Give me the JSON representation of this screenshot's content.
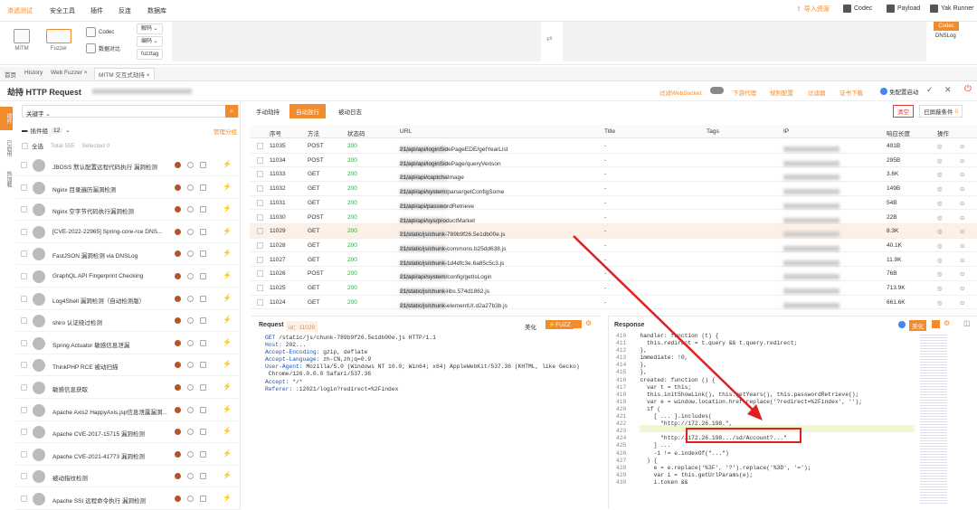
{
  "menubar": {
    "items": [
      "渗透测试",
      "安全工具",
      "插件",
      "反连",
      "数据库"
    ],
    "right": [
      "导入资源",
      "Codec",
      "Payload",
      "Yak Runner"
    ]
  },
  "toolbar": {
    "mitm": "MITM",
    "fuzzer": "Fuzzer",
    "codec": "Codec",
    "compare": "数据对比",
    "decode": "解码",
    "encode": "编码",
    "fuzztag": "fuzztag",
    "codec_tag": "Codec",
    "dnslog": "DNSLog"
  },
  "tabs": [
    "首页",
    "History",
    "Web Fuzzer",
    "MITM 交互式劫持"
  ],
  "header": {
    "title": "劫持 HTTP Request",
    "filter_ws": "过滤WebSocket:",
    "dl_proxy": "下游代理",
    "rule_config": "规则配置",
    "filter": "过滤器",
    "cert": "证书下载",
    "fav_launch": "免配置启动"
  },
  "side_tabs": [
    "插件",
    "已启用",
    "热加载"
  ],
  "left": {
    "keyword": "关键字",
    "plugin_group": "插件组",
    "group_count": "12",
    "manage_group": "管理分组",
    "select_all": "全选",
    "total": "Total 555",
    "selected": "Selected 0",
    "plugins": [
      "JBOSS 默认配置远程代码执行 漏洞检测",
      "Nginx 目录遍历漏洞检测",
      "Nginx 空字节代码执行漏洞检测",
      "[CVE-2022-22965] Spring-core-rce DNS...",
      "FastJSON 漏洞检测 via DNSLog",
      "GraphQL API Fingerprint Checking",
      "Log4Shell 漏洞检测（自动检测版）",
      "shiro 认证绕过检测",
      "Spring Actuator 敏感信息泄漏",
      "ThinkPHP RCE 被动扫描",
      "敏感信息获取",
      "Apache Axis2 HappyAxis.jsp信息泄露漏洞...",
      "Apache CVE-2017-15715 漏洞检测",
      "Apache CVE-2021-41773 漏洞检测",
      "被动指纹检测",
      "Apache SSI 远程命令执行 漏洞检测"
    ]
  },
  "modes": [
    "手动劫持",
    "自动放行",
    "被动日志"
  ],
  "grid_actions": {
    "clear": "清空",
    "hide": "已屏蔽条件",
    "hide_count": "0"
  },
  "columns": [
    "序号",
    "方法",
    "状态码",
    "URL",
    "Title",
    "Tags",
    "IP",
    "响应长度",
    "操作"
  ],
  "rows": [
    {
      "id": "11035",
      "m": "POST",
      "s": "200",
      "u": "21/api/api/loginSidePageEDE/getYearList",
      "len": "491B"
    },
    {
      "id": "11034",
      "m": "POST",
      "s": "200",
      "u": "21/api/api/loginSidePage/queryVerison",
      "len": "295B"
    },
    {
      "id": "11033",
      "m": "GET",
      "s": "200",
      "u": "21/api/api/captchaImage",
      "len": "3.6K"
    },
    {
      "id": "11032",
      "m": "GET",
      "s": "200",
      "u": "21/api/api/system/parse/getConfigSome",
      "len": "149B"
    },
    {
      "id": "11031",
      "m": "GET",
      "s": "200",
      "u": "21/api/api/passwordRetrieve",
      "len": "54B"
    },
    {
      "id": "11030",
      "m": "POST",
      "s": "200",
      "u": "21/api/api/sys/productMarket",
      "len": "22B"
    },
    {
      "id": "11029",
      "m": "GET",
      "s": "200",
      "u": "21/static/js/chunk-789b9f26.5e1db00e.js",
      "len": "8.3K"
    },
    {
      "id": "11028",
      "m": "GET",
      "s": "200",
      "u": "21/static/js/chunk-commons.b25dd638.js",
      "len": "40.1K"
    },
    {
      "id": "11027",
      "m": "GET",
      "s": "200",
      "u": "21/static/js/chunk-1d4dfc3e.6a85c5c3.js",
      "len": "11.9K"
    },
    {
      "id": "11026",
      "m": "POST",
      "s": "200",
      "u": "21/api/api/system/config/getIsLogin",
      "len": "76B"
    },
    {
      "id": "11025",
      "m": "GET",
      "s": "200",
      "u": "21/static/js/chunk-libs.574d1862.js",
      "len": "713.9K"
    },
    {
      "id": "11024",
      "m": "GET",
      "s": "200",
      "u": "21/static/js/chunk-elementUI.d2a27b3b.js",
      "len": "661.6K"
    }
  ],
  "url_prefix": "http://",
  "title_dash": "-",
  "request": {
    "label": "Request",
    "id": "id：11029",
    "beautify": "美化",
    "fuzz": "FUZZ",
    "lines": [
      [
        "GET",
        "/static/js/chunk-789b9f26.5e1db00e.js HTTP/1.1"
      ],
      [
        "Host:",
        "202..."
      ],
      [
        "Accept-Encoding:",
        "gzip, deflate"
      ],
      [
        "Accept-Language:",
        "zh-CN,zh;q=0.9"
      ],
      [
        "User-Agent:",
        "Mozilla/5.0 (Windows NT 10.0; Win64; x64) AppleWebKit/537.36 (KHTML, like Gecko)"
      ],
      [
        "",
        "Chrome/126.0.0.0 Safari/537.36"
      ],
      [
        "Accept:",
        "*/*"
      ],
      [
        "Referer:",
        ":12021/login?redirect=%2Findex"
      ]
    ]
  },
  "response": {
    "label": "Response",
    "beautify": "美化",
    "lines": [
      [
        "410",
        "handler: function (t) {"
      ],
      [
        "411",
        "  this.redirect = t.query && t.query.redirect;"
      ],
      [
        "412",
        "},"
      ],
      [
        "413",
        "immediate: !0,"
      ],
      [
        "414",
        "},"
      ],
      [
        "415",
        "},"
      ],
      [
        "416",
        "created: function () {"
      ],
      [
        "417",
        "  var t = this;"
      ],
      [
        "418",
        "  this.initShowLink(), this.getYears(), this.passwordRetrieve();"
      ],
      [
        "419",
        "  var e = window.location.href.replace('?redirect=%2Findex', '');"
      ],
      [
        "420",
        "  if ("
      ],
      [
        "421",
        "    [ ... ].includes("
      ],
      [
        "422",
        "      \"http://172.26.198.\","
      ],
      [
        "423",
        ""
      ],
      [
        "424",
        "      \"http://172.26.198.../sd/Account?...\""
      ],
      [
        "425",
        "    ] ..."
      ],
      [
        "426",
        "    -1 != e.indexOf(\"...\")"
      ],
      [
        "427",
        "  ) {"
      ],
      [
        "428",
        "    e = e.replace('%3F', '?').replace('%3D', '=');"
      ],
      [
        "429",
        "    var i = this.getUrlParams(e);"
      ],
      [
        "430",
        "    i.token &&"
      ]
    ]
  }
}
